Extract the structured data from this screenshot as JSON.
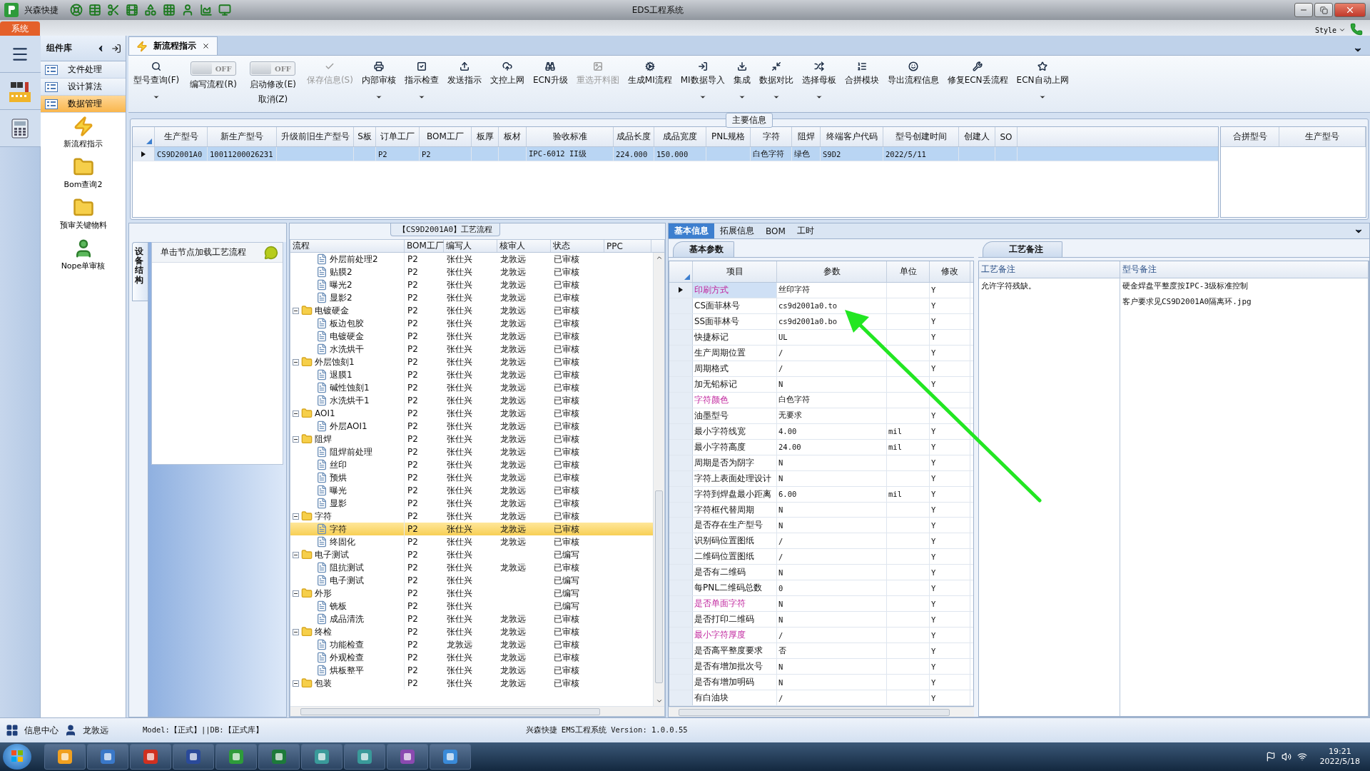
{
  "window": {
    "app_name": "兴森快捷",
    "title": "EDS工程系统"
  },
  "ribbon": {
    "tabs": [
      {
        "label": "系统",
        "selected": true
      }
    ],
    "style_label": "Style"
  },
  "component_panel": {
    "title": "组件库",
    "menu": [
      {
        "label": "文件处理",
        "selected": false
      },
      {
        "label": "设计算法",
        "selected": false
      },
      {
        "label": "数据管理",
        "selected": true
      }
    ],
    "items": [
      {
        "label": "新流程指示",
        "kind": "bolt"
      },
      {
        "label": "Bom查询2",
        "kind": "folder"
      },
      {
        "label": "预审关键物料",
        "kind": "folder"
      },
      {
        "label": "Nope单审核",
        "kind": "person"
      }
    ]
  },
  "document_tabs": [
    {
      "label": "新流程指示",
      "selected": true
    }
  ],
  "toolbar": [
    {
      "kind": "button",
      "label": "型号查询(F)",
      "disabled": false,
      "dropdown": true
    },
    {
      "kind": "toggle",
      "label": "编写流程(R)",
      "state": "OFF",
      "on": false
    },
    {
      "kind": "toggle",
      "label": "启动修改(E)",
      "second_label": "取消(Z)",
      "state": "OFF",
      "on": false
    },
    {
      "kind": "button",
      "label": "保存信息(S)",
      "disabled": true,
      "dropdown": false
    },
    {
      "kind": "button",
      "label": "内部审核",
      "disabled": false,
      "dropdown": true
    },
    {
      "kind": "button",
      "label": "指示检查",
      "disabled": false,
      "dropdown": true
    },
    {
      "kind": "button",
      "label": "发送指示",
      "disabled": false,
      "dropdown": false
    },
    {
      "kind": "button",
      "label": "文控上网",
      "disabled": false,
      "dropdown": false
    },
    {
      "kind": "button",
      "label": "ECN升级",
      "disabled": false,
      "dropdown": false
    },
    {
      "kind": "button",
      "label": "重选开料图",
      "disabled": true,
      "dropdown": false
    },
    {
      "kind": "button",
      "label": "生成MI流程",
      "disabled": false,
      "dropdown": false
    },
    {
      "kind": "button",
      "label": "MI数据导入",
      "disabled": false,
      "dropdown": true
    },
    {
      "kind": "button",
      "label": "集成",
      "disabled": false,
      "dropdown": true
    },
    {
      "kind": "button",
      "label": "数据对比",
      "disabled": false,
      "dropdown": true
    },
    {
      "kind": "button",
      "label": "选择母板",
      "disabled": false,
      "dropdown": true
    },
    {
      "kind": "button",
      "label": "合拼模块",
      "disabled": false,
      "dropdown": false
    },
    {
      "kind": "button",
      "label": "导出流程信息",
      "disabled": false,
      "dropdown": false
    },
    {
      "kind": "button",
      "label": "修复ECN丢流程",
      "disabled": false,
      "dropdown": false
    },
    {
      "kind": "button",
      "label": "ECN自动上网",
      "disabled": false,
      "dropdown": true
    }
  ],
  "main_info": {
    "title": "主要信息",
    "columns": [
      "生产型号",
      "新生产型号",
      "升级前旧生产型号",
      "S板",
      "订单工厂",
      "BOM工厂",
      "板厚",
      "板材",
      "验收标准",
      "成品长度",
      "成品宽度",
      "PNL规格",
      "字符",
      "阻焊",
      "终端客户代码",
      "型号创建时间",
      "创建人",
      "SO"
    ],
    "rows": [
      {
        "selected": true,
        "cells": [
          "CS9D2001A0",
          "10011200026231",
          null,
          null,
          "P2",
          "P2",
          null,
          null,
          "IPC-6012 II级",
          "224.000",
          "150.000",
          null,
          "白色字符",
          "绿色",
          "S9D2",
          "2022/5/11",
          null,
          null
        ]
      }
    ],
    "side_columns": [
      "合拼型号",
      "生产型号"
    ]
  },
  "left_panel": {
    "tab": "设备结构",
    "hint": "单击节点加载工艺流程"
  },
  "process": {
    "title": "【CS9D2001A0】工艺流程",
    "columns": [
      "流程",
      "BOM工厂",
      "编写人",
      "核审人",
      "状态",
      "PPC"
    ],
    "rows": [
      {
        "children": [
          {
            "label": "外层前处理2",
            "bom": "P2",
            "writer": "张仕兴",
            "reviewer": "龙敦远",
            "status": "已审核",
            "selected": false
          },
          {
            "label": "贴膜2",
            "bom": "P2",
            "writer": "张仕兴",
            "reviewer": "龙敦远",
            "status": "已审核",
            "selected": false
          },
          {
            "label": "曝光2",
            "bom": "P2",
            "writer": "张仕兴",
            "reviewer": "龙敦远",
            "status": "已审核",
            "selected": false
          },
          {
            "label": "显影2",
            "bom": "P2",
            "writer": "张仕兴",
            "reviewer": "龙敦远",
            "status": "已审核",
            "selected": false
          }
        ]
      },
      {
        "label": "电镀硬金",
        "bom": "P2",
        "writer": "张仕兴",
        "reviewer": "龙敦远",
        "status": "已审核",
        "selected": false,
        "expanded": true,
        "children": [
          {
            "label": "板边包胶",
            "bom": "P2",
            "writer": "张仕兴",
            "reviewer": "龙敦远",
            "status": "已审核",
            "selected": false
          },
          {
            "label": "电镀硬金",
            "bom": "P2",
            "writer": "张仕兴",
            "reviewer": "龙敦远",
            "status": "已审核",
            "selected": false
          },
          {
            "label": "水洗烘干",
            "bom": "P2",
            "writer": "张仕兴",
            "reviewer": "龙敦远",
            "status": "已审核",
            "selected": false
          }
        ]
      },
      {
        "label": "外层蚀刻1",
        "bom": "P2",
        "writer": "张仕兴",
        "reviewer": "龙敦远",
        "status": "已审核",
        "selected": false,
        "expanded": true,
        "children": [
          {
            "label": "退膜1",
            "bom": "P2",
            "writer": "张仕兴",
            "reviewer": "龙敦远",
            "status": "已审核",
            "selected": false
          },
          {
            "label": "碱性蚀刻1",
            "bom": "P2",
            "writer": "张仕兴",
            "reviewer": "龙敦远",
            "status": "已审核",
            "selected": false
          },
          {
            "label": "水洗烘干1",
            "bom": "P2",
            "writer": "张仕兴",
            "reviewer": "龙敦远",
            "status": "已审核",
            "selected": false
          }
        ]
      },
      {
        "label": "AOI1",
        "bom": "P2",
        "writer": "张仕兴",
        "reviewer": "龙敦远",
        "status": "已审核",
        "selected": false,
        "expanded": true,
        "children": [
          {
            "label": "外层AOI1",
            "bom": "P2",
            "writer": "张仕兴",
            "reviewer": "龙敦远",
            "status": "已审核",
            "selected": false
          }
        ]
      },
      {
        "label": "阻焊",
        "bom": "P2",
        "writer": "张仕兴",
        "reviewer": "龙敦远",
        "status": "已审核",
        "selected": false,
        "expanded": true,
        "children": [
          {
            "label": "阻焊前处理",
            "bom": "P2",
            "writer": "张仕兴",
            "reviewer": "龙敦远",
            "status": "已审核",
            "selected": false
          },
          {
            "label": "丝印",
            "bom": "P2",
            "writer": "张仕兴",
            "reviewer": "龙敦远",
            "status": "已审核",
            "selected": false
          },
          {
            "label": "预烘",
            "bom": "P2",
            "writer": "张仕兴",
            "reviewer": "龙敦远",
            "status": "已审核",
            "selected": false
          },
          {
            "label": "曝光",
            "bom": "P2",
            "writer": "张仕兴",
            "reviewer": "龙敦远",
            "status": "已审核",
            "selected": false
          },
          {
            "label": "显影",
            "bom": "P2",
            "writer": "张仕兴",
            "reviewer": "龙敦远",
            "status": "已审核",
            "selected": false
          }
        ]
      },
      {
        "label": "字符",
        "bom": "P2",
        "writer": "张仕兴",
        "reviewer": "龙敦远",
        "status": "已审核",
        "selected": false,
        "expanded": true,
        "children": [
          {
            "label": "字符",
            "bom": "P2",
            "writer": "张仕兴",
            "reviewer": "龙敦远",
            "status": "已审核",
            "selected": true
          },
          {
            "label": "终固化",
            "bom": "P2",
            "writer": "张仕兴",
            "reviewer": "龙敦远",
            "status": "已审核",
            "selected": false
          }
        ]
      },
      {
        "label": "电子测试",
        "bom": "P2",
        "writer": "张仕兴",
        "status": "已编写",
        "selected": false,
        "expanded": true,
        "children": [
          {
            "label": "阻抗测试",
            "bom": "P2",
            "writer": "张仕兴",
            "reviewer": "龙敦远",
            "status": "已审核",
            "selected": false
          },
          {
            "label": "电子测试",
            "bom": "P2",
            "writer": "张仕兴",
            "status": "已编写",
            "selected": false
          }
        ]
      },
      {
        "label": "外形",
        "bom": "P2",
        "writer": "张仕兴",
        "status": "已编写",
        "selected": false,
        "expanded": true,
        "children": [
          {
            "label": "铣板",
            "bom": "P2",
            "writer": "张仕兴",
            "status": "已编写",
            "selected": false
          },
          {
            "label": "成品清洗",
            "bom": "P2",
            "writer": "张仕兴",
            "reviewer": "龙敦远",
            "status": "已审核",
            "selected": false
          }
        ]
      },
      {
        "label": "终检",
        "bom": "P2",
        "writer": "张仕兴",
        "reviewer": "龙敦远",
        "status": "已审核",
        "selected": false,
        "expanded": true,
        "children": [
          {
            "label": "功能检查",
            "bom": "P2",
            "writer": "龙敦远",
            "reviewer": "龙敦远",
            "status": "已审核",
            "selected": false
          },
          {
            "label": "外观检查",
            "bom": "P2",
            "writer": "张仕兴",
            "reviewer": "龙敦远",
            "status": "已审核",
            "selected": false
          },
          {
            "label": "烘板整平",
            "bom": "P2",
            "writer": "张仕兴",
            "reviewer": "龙敦远",
            "status": "已审核",
            "selected": false
          }
        ]
      },
      {
        "label": "包装",
        "bom": "P2",
        "writer": "张仕兴",
        "reviewer": "龙敦远",
        "status": "已审核",
        "selected": false,
        "expanded": true
      }
    ]
  },
  "detail": {
    "tabs": [
      {
        "label": "基本信息",
        "selected": true
      },
      {
        "label": "拓展信息",
        "selected": false
      },
      {
        "label": "BOM",
        "selected": false
      },
      {
        "label": "工时",
        "selected": false
      }
    ],
    "params_tab": "基本参数",
    "columns": [
      "项目",
      "参数",
      "单位",
      "修改"
    ],
    "rows": [
      {
        "item": "印刷方式",
        "value": "丝印字符",
        "modified": "Y",
        "highlighted": true,
        "selected": true
      },
      {
        "item": "CS面菲林号",
        "value": "cs9d2001a0.to",
        "modified": "Y",
        "highlighted": false,
        "selected": false
      },
      {
        "item": "SS面菲林号",
        "value": "cs9d2001a0.bo",
        "modified": "Y",
        "highlighted": false,
        "selected": false
      },
      {
        "item": "快捷标记",
        "value": "UL",
        "modified": "Y",
        "highlighted": false,
        "selected": false
      },
      {
        "item": "生产周期位置",
        "value": "/",
        "modified": "Y",
        "highlighted": false,
        "selected": false
      },
      {
        "item": "周期格式",
        "value": "/",
        "modified": "Y",
        "highlighted": false,
        "selected": false
      },
      {
        "item": "加无铅标记",
        "value": "N",
        "modified": "Y",
        "highlighted": false,
        "selected": false
      },
      {
        "item": "字符颜色",
        "value": "白色字符",
        "highlighted": true,
        "selected": false
      },
      {
        "item": "油墨型号",
        "value": "无要求",
        "modified": "Y",
        "highlighted": false,
        "selected": false
      },
      {
        "item": "最小字符线宽",
        "value": "4.00",
        "unit": "mil",
        "modified": "Y",
        "highlighted": false,
        "selected": false
      },
      {
        "item": "最小字符高度",
        "value": "24.00",
        "unit": "mil",
        "modified": "Y",
        "highlighted": false,
        "selected": false
      },
      {
        "item": "周期是否为阴字",
        "value": "N",
        "modified": "Y",
        "highlighted": false,
        "selected": false
      },
      {
        "item": "字符上表面处理设计",
        "value": "N",
        "modified": "Y",
        "highlighted": false,
        "selected": false
      },
      {
        "item": "字符到焊盘最小距离",
        "value": "6.00",
        "unit": "mil",
        "modified": "Y",
        "highlighted": false,
        "selected": false
      },
      {
        "item": "字符框代替周期",
        "value": "N",
        "modified": "Y",
        "highlighted": false,
        "selected": false
      },
      {
        "item": "是否存在生产型号",
        "value": "N",
        "modified": "Y",
        "highlighted": false,
        "selected": false
      },
      {
        "item": "识别码位置图纸",
        "value": "/",
        "modified": "Y",
        "highlighted": false,
        "selected": false
      },
      {
        "item": "二维码位置图纸",
        "value": "/",
        "modified": "Y",
        "highlighted": false,
        "selected": false
      },
      {
        "item": "是否有二维码",
        "value": "N",
        "modified": "Y",
        "highlighted": false,
        "selected": false
      },
      {
        "item": "每PNL二维码总数",
        "value": "0",
        "modified": "Y",
        "highlighted": false,
        "selected": false
      },
      {
        "item": "是否单面字符",
        "value": "N",
        "modified": "Y",
        "highlighted": true,
        "selected": false
      },
      {
        "item": "是否打印二维码",
        "value": "N",
        "modified": "Y",
        "highlighted": false,
        "selected": false
      },
      {
        "item": "最小字符厚度",
        "value": "/",
        "modified": "Y",
        "highlighted": true,
        "selected": false
      },
      {
        "item": "是否高平整度要求",
        "value": "否",
        "modified": "Y",
        "highlighted": false,
        "selected": false
      },
      {
        "item": "是否有增加批次号",
        "value": "N",
        "modified": "Y",
        "highlighted": false,
        "selected": false
      },
      {
        "item": "是否有增加明码",
        "value": "N",
        "modified": "Y",
        "highlighted": false,
        "selected": false
      },
      {
        "item": "有白油块",
        "value": "/",
        "modified": "Y",
        "highlighted": false,
        "selected": false
      }
    ]
  },
  "notes": {
    "tab": "工艺备注",
    "columns": [
      "工艺备注",
      "型号备注"
    ],
    "process_notes": [
      "允许字符残缺。"
    ],
    "model_notes": [
      "硬金焊盘平整度按IPC-3级标准控制",
      "客户要求见CS9D2001A0隔离环.jpg"
    ]
  },
  "status_bar": {
    "info": "信息中心",
    "user": "龙敦远",
    "model": "Model:【正式】||DB:【正式库】",
    "version": "兴森快捷 EMS工程系统 Version: 1.0.0.55"
  },
  "taskbar": {
    "time": "19:21",
    "date": "2022/5/18"
  }
}
